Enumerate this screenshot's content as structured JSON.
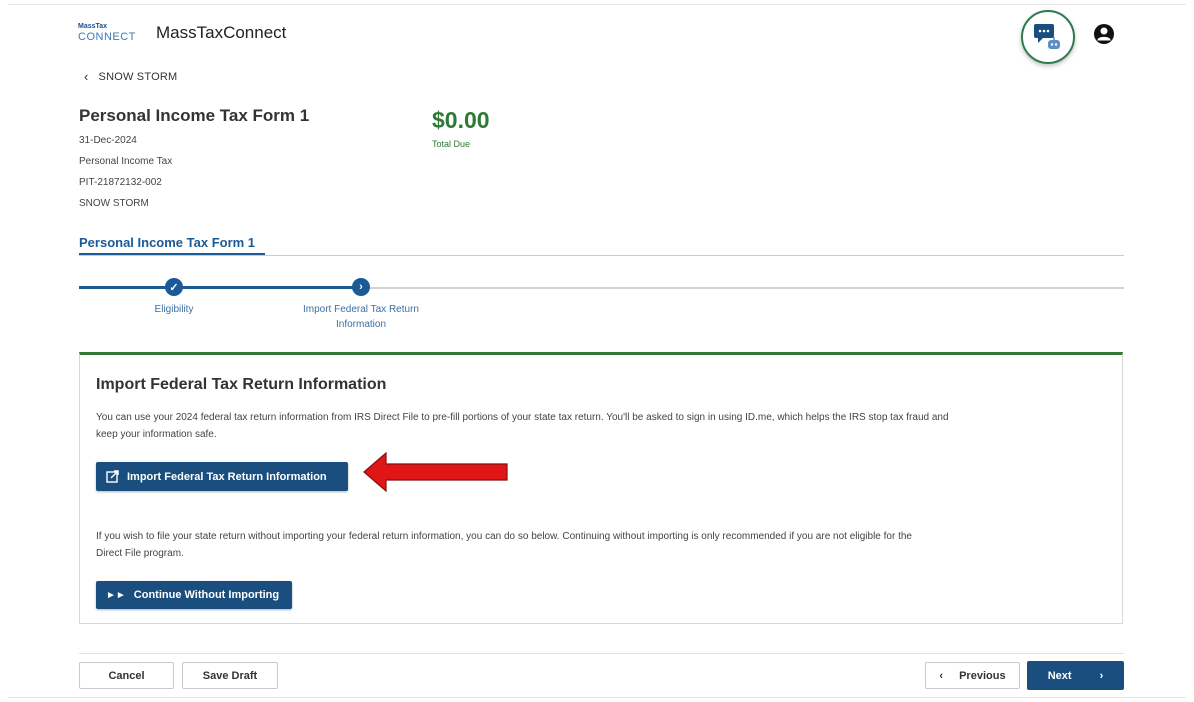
{
  "header": {
    "logo_line1": "MassTax",
    "logo_line2": "CONNECT",
    "app_title": "MassTaxConnect",
    "back_label": "SNOW STORM"
  },
  "summary": {
    "form_title": "Personal Income Tax Form 1",
    "date": "31-Dec-2024",
    "tax_type": "Personal Income Tax",
    "account_id": "PIT-21872132-002",
    "name": "SNOW STORM",
    "amount": "$0.00",
    "amount_label": "Total Due"
  },
  "section_tab": "Personal Income Tax Form 1",
  "stepper": {
    "steps": [
      {
        "label": "Eligibility",
        "status": "complete"
      },
      {
        "label_line1": "Import Federal Tax Return",
        "label_line2": "Information",
        "status": "current"
      }
    ]
  },
  "card": {
    "title": "Import Federal Tax Return Information",
    "intro_line1": "You can use your 2024 federal tax return information from IRS Direct File to pre-fill portions of your state tax return. You'll be asked to sign in using ID.me, which helps the IRS stop tax fraud and",
    "intro_line2": "keep your information safe.",
    "import_button": "Import Federal Tax Return Information",
    "alt_line1": "If you wish to file your state return without importing your federal return information, you can do so below. Continuing without importing is only recommended if you are not eligible for the",
    "alt_line2": "Direct File program.",
    "continue_button": "Continue Without Importing"
  },
  "footer": {
    "cancel": "Cancel",
    "save_draft": "Save Draft",
    "previous": "Previous",
    "next": "Next"
  },
  "colors": {
    "primary": "#1a4e7e",
    "accent_green": "#2e7a35",
    "annotation_red": "#e01515"
  }
}
